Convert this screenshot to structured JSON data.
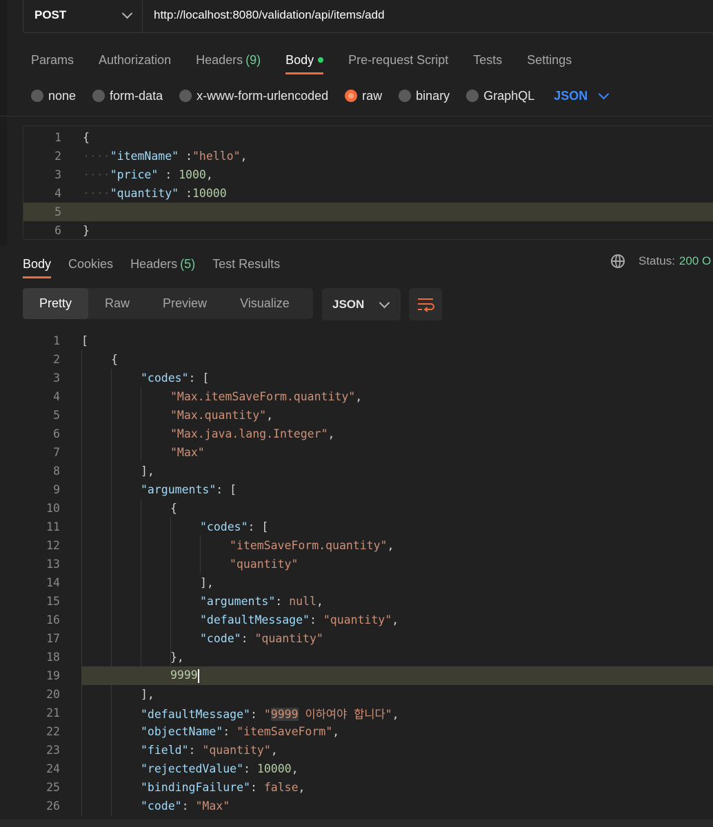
{
  "request": {
    "method": "POST",
    "url": "http://localhost:8080/validation/api/items/add"
  },
  "request_tabs": [
    {
      "label": "Params"
    },
    {
      "label": "Authorization"
    },
    {
      "label": "Headers",
      "count": "(9)"
    },
    {
      "label": "Body",
      "active": true
    },
    {
      "label": "Pre-request Script"
    },
    {
      "label": "Tests"
    },
    {
      "label": "Settings"
    }
  ],
  "body_types": [
    {
      "label": "none"
    },
    {
      "label": "form-data"
    },
    {
      "label": "x-www-form-urlencoded"
    },
    {
      "label": "raw",
      "selected": true
    },
    {
      "label": "binary"
    },
    {
      "label": "GraphQL"
    }
  ],
  "body_format": "JSON",
  "request_body": {
    "line_numbers": [
      "1",
      "2",
      "3",
      "4",
      "5",
      "6"
    ],
    "open": "{",
    "l2_key": "\"itemName\"",
    "l2_sep": " :",
    "l2_val": "\"hello\"",
    "l2_end": ",",
    "l3_key": "\"price\"",
    "l3_sep": " : ",
    "l3_val": "1000",
    "l3_end": ",",
    "l4_key": "\"quantity\"",
    "l4_sep": " :",
    "l4_val": "10000",
    "close": "}"
  },
  "response_tabs": [
    {
      "label": "Body",
      "active": true
    },
    {
      "label": "Cookies"
    },
    {
      "label": "Headers",
      "count": "(5)"
    },
    {
      "label": "Test Results"
    }
  ],
  "status": {
    "label": "Status:",
    "value": "200 O"
  },
  "view_modes": [
    "Pretty",
    "Raw",
    "Preview",
    "Visualize"
  ],
  "response_format": "JSON",
  "response_body": {
    "line_numbers": [
      "1",
      "2",
      "3",
      "4",
      "5",
      "6",
      "7",
      "8",
      "9",
      "10",
      "11",
      "12",
      "13",
      "14",
      "15",
      "16",
      "17",
      "18",
      "19",
      "20",
      "21",
      "22",
      "23",
      "24",
      "25",
      "26"
    ],
    "l1": "[",
    "l2": "{",
    "l3_key": "\"codes\"",
    "l3_rest": ": [",
    "l4": "\"Max.itemSaveForm.quantity\"",
    "l5": "\"Max.quantity\"",
    "l6": "\"Max.java.lang.Integer\"",
    "l7": "\"Max\"",
    "l8": "],",
    "l9_key": "\"arguments\"",
    "l9_rest": ": [",
    "l10": "{",
    "l11_key": "\"codes\"",
    "l11_rest": ": [",
    "l12": "\"itemSaveForm.quantity\"",
    "l13": "\"quantity\"",
    "l14": "],",
    "l15_key": "\"arguments\"",
    "l15_val": "null",
    "l16_key": "\"defaultMessage\"",
    "l16_val": "\"quantity\"",
    "l17_key": "\"code\"",
    "l17_val": "\"quantity\"",
    "l18": "},",
    "l19": "9999",
    "l20": "],",
    "l21_key": "\"defaultMessage\"",
    "l21_q": "\"",
    "l21_sel": "9999",
    "l21_rest": " 이하여야 합니다\"",
    "l22_key": "\"objectName\"",
    "l22_val": "\"itemSaveForm\"",
    "l23_key": "\"field\"",
    "l23_val": "\"quantity\"",
    "l24_key": "\"rejectedValue\"",
    "l24_val": "10000",
    "l25_key": "\"bindingFailure\"",
    "l25_val": "false",
    "l26_key": "\"code\"",
    "l26_val": "\"Max\""
  }
}
